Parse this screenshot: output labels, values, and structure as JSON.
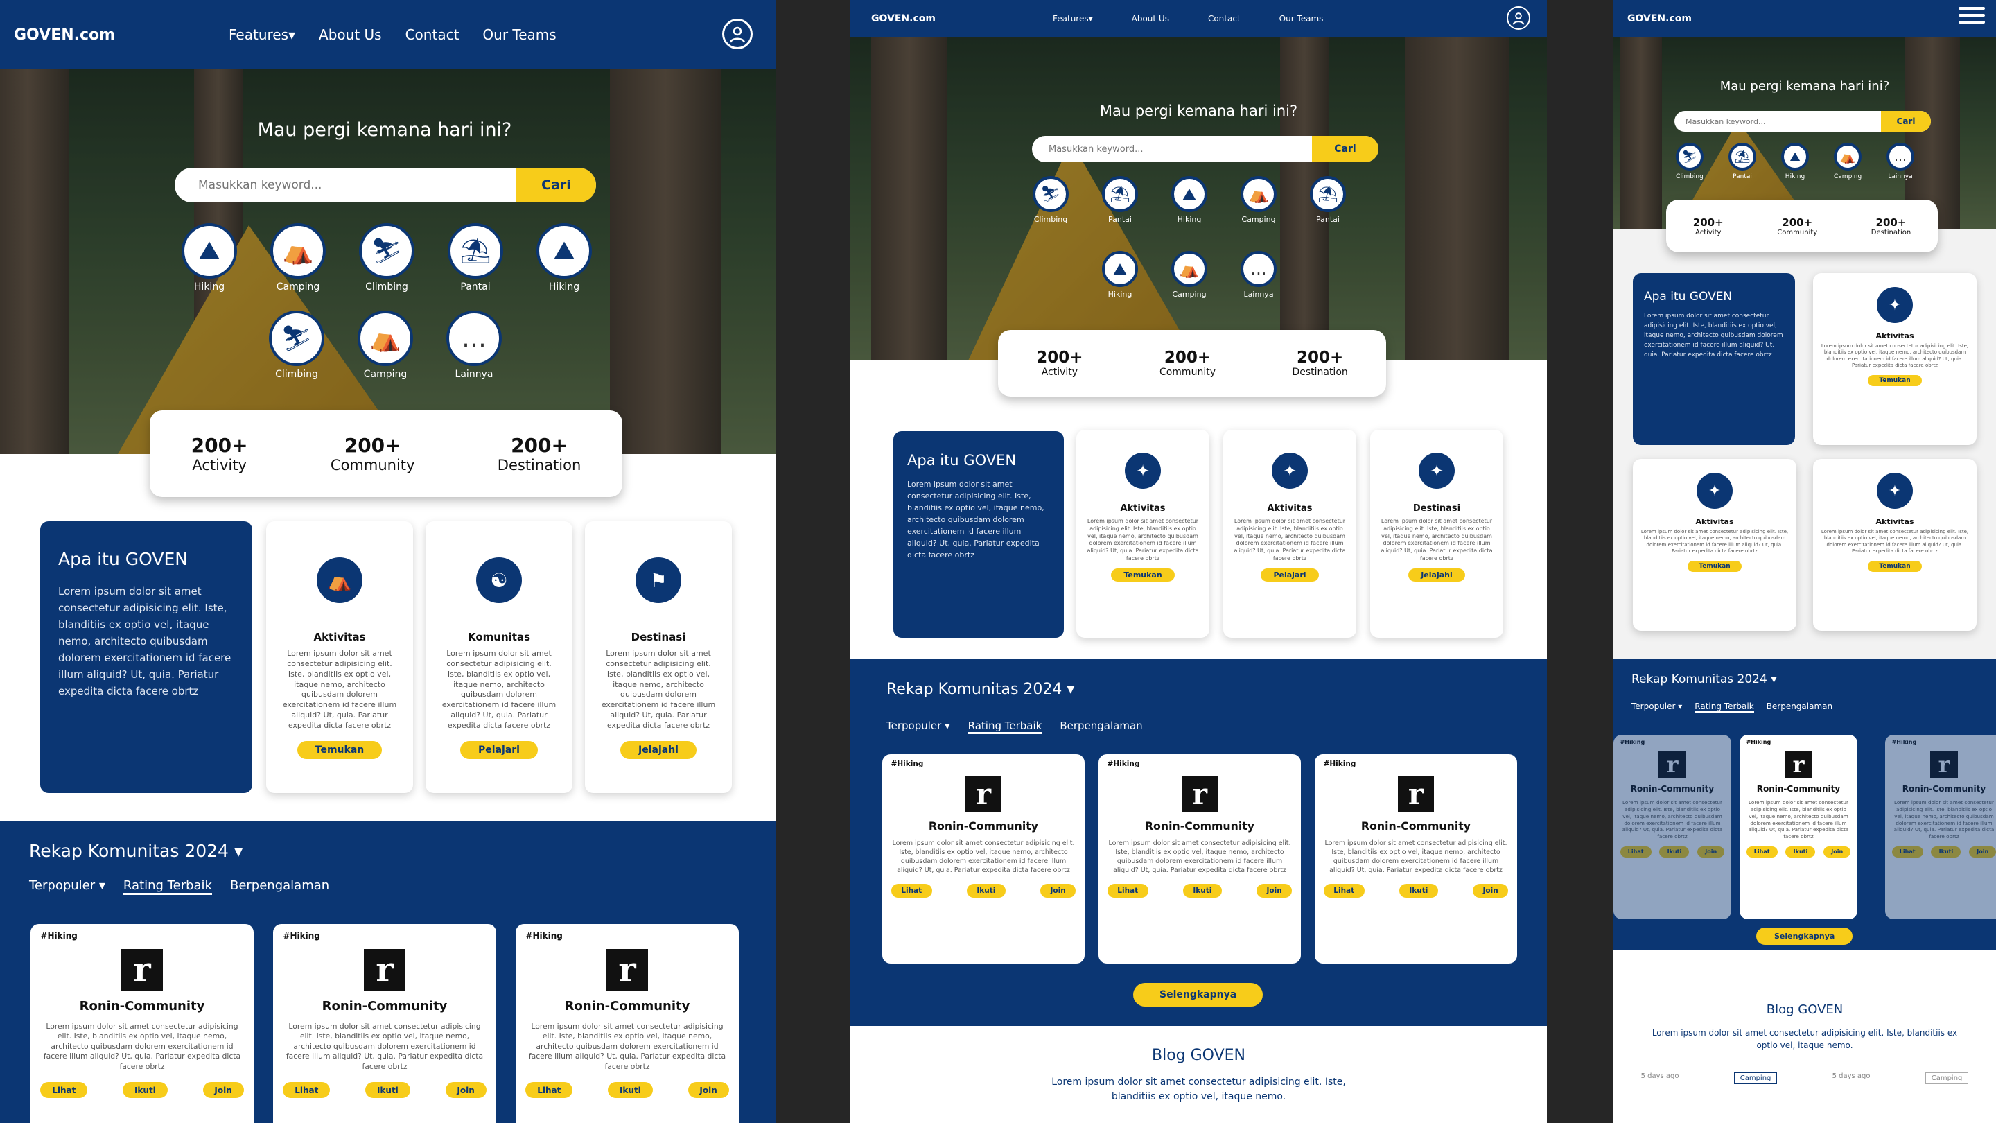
{
  "brand": "GOVEN.com",
  "nav": {
    "features": "Features▾",
    "about": "About Us",
    "contact": "Contact",
    "teams": "Our Teams"
  },
  "hero": {
    "title": "Mau pergi kemana hari ini?",
    "search_placeholder": "Masukkan keyword...",
    "search_button": "Cari"
  },
  "categories_a": [
    "Hiking",
    "Camping",
    "Climbing",
    "Pantai",
    "Hiking"
  ],
  "categories_b": [
    "Climbing",
    "Camping",
    "Lainnya"
  ],
  "categories_mid_a": [
    "Climbing",
    "Pantai",
    "Hiking",
    "Camping",
    "Pantai"
  ],
  "categories_mid_b": [
    "Hiking",
    "Camping",
    "Lainnya"
  ],
  "categories_right": [
    "Climbing",
    "Pantai",
    "Hiking",
    "Camping",
    "Lainnya"
  ],
  "stats": [
    {
      "value": "200+",
      "label": "Activity"
    },
    {
      "value": "200+",
      "label": "Community"
    },
    {
      "value": "200+",
      "label": "Destination"
    }
  ],
  "about": {
    "title": "Apa itu GOVEN",
    "text": "Lorem ipsum dolor sit amet consectetur adipisicing elit. Iste, blanditiis ex optio vel, itaque nemo, architecto quibusdam dolorem exercitationem id facere illum aliquid? Ut, quia. Pariatur expedita dicta facere obrtz"
  },
  "features_left": [
    {
      "title": "Aktivitas",
      "text": "Lorem ipsum dolor sit amet consectetur adipisicing elit. Iste, blanditiis ex optio vel, itaque nemo, architecto quibusdam dolorem exercitationem id facere illum aliquid? Ut, quia. Pariatur expedita dicta facere obrtz",
      "button": "Temukan"
    },
    {
      "title": "Komunitas",
      "text": "Lorem ipsum dolor sit amet consectetur adipisicing elit. Iste, blanditiis ex optio vel, itaque nemo, architecto quibusdam dolorem exercitationem id facere illum aliquid? Ut, quia. Pariatur expedita dicta facere obrtz",
      "button": "Pelajari"
    },
    {
      "title": "Destinasi",
      "text": "Lorem ipsum dolor sit amet consectetur adipisicing elit. Iste, blanditiis ex optio vel, itaque nemo, architecto quibusdam dolorem exercitationem id facere illum aliquid? Ut, quia. Pariatur expedita dicta facere obrtz",
      "button": "Jelajahi"
    }
  ],
  "features_mid": [
    {
      "title": "Aktivitas",
      "button": "Temukan"
    },
    {
      "title": "Aktivitas",
      "button": "Pelajari"
    },
    {
      "title": "Destinasi",
      "button": "Jelajahi"
    }
  ],
  "features_right": [
    {
      "title": "Aktivitas",
      "button": "Temukan"
    },
    {
      "title": "Aktivitas",
      "button": "Temukan"
    },
    {
      "title": "Aktivitas",
      "button": "Temukan"
    }
  ],
  "recap": {
    "title": "Rekap Komunitas 2024 ▾",
    "tabs": [
      "Terpopuler ▾",
      "Rating Terbaik",
      "Berpengalaman"
    ]
  },
  "community": {
    "tag": "#Hiking",
    "logo": "r",
    "name": "Ronin-Community",
    "text": "Lorem ipsum dolor sit amet consectetur adipisicing elit. Iste, blanditiis ex optio vel, itaque nemo, architecto quibusdam dolorem exercitationem id facere illum aliquid? Ut, quia. Pariatur expedita dicta facere obrtz",
    "buttons": [
      "Lihat",
      "Ikuti",
      "Join"
    ]
  },
  "more_button": "Selengkapnya",
  "blog": {
    "title": "Blog GOVEN",
    "text": "Lorem ipsum dolor sit amet consectetur adipisicing elit. Iste, blanditiis ex optio vel, itaque nemo.",
    "tag_a": "5 days ago",
    "tag_b": "Camping",
    "tag_c": "5 days ago",
    "tag_d": "Camping"
  },
  "colors": {
    "primary": "#0b3673",
    "accent": "#f7cc1a"
  }
}
